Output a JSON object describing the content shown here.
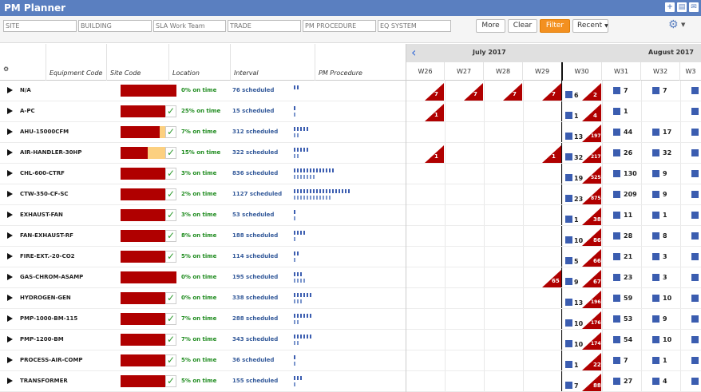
{
  "app": {
    "title": "PM Planner"
  },
  "filters": {
    "site": "SITE",
    "building": "BUILDING",
    "team": "SLA Work Team",
    "trade": "TRADE",
    "procedure": "PM PROCEDURE",
    "eqsystem": "EQ SYSTEM"
  },
  "buttons": {
    "more": "More",
    "clear": "Clear",
    "filter": "Filter",
    "recent": "Recent"
  },
  "columns": [
    "Equipment Code",
    "Site Code",
    "Location",
    "Interval",
    "PM Procedure"
  ],
  "calendar": {
    "months": [
      "July 2017",
      "August 2017"
    ],
    "weeks": [
      "W26",
      "W27",
      "W28",
      "W29",
      "W30",
      "W31",
      "W32",
      "W3"
    ]
  },
  "rows": [
    {
      "code": "N/A",
      "pct": "0% on time",
      "sch": "76 scheduled",
      "amber": 0,
      "check": false,
      "pm": [
        2,
        0
      ],
      "tri": {
        "0": "7",
        "1": "7",
        "2": "7",
        "3": "7"
      },
      "w30": {
        "n": "6",
        "t": "2"
      },
      "w31": "7",
      "w32": "7"
    },
    {
      "code": "A-PC",
      "pct": "25% on time",
      "sch": "15 scheduled",
      "amber": 0,
      "check": true,
      "pm": [
        1,
        1
      ],
      "tri": {
        "0": "1"
      },
      "w30": {
        "n": "1",
        "t": "4"
      },
      "w31": "1",
      "w32": ""
    },
    {
      "code": "AHU-15000CFM",
      "pct": "7% on time",
      "sch": "312 scheduled",
      "amber": 0.12,
      "check": true,
      "pm": [
        5,
        2
      ],
      "tri": {},
      "w30": {
        "n": "13",
        "t": "197"
      },
      "w31": "44",
      "w32": "17"
    },
    {
      "code": "AIR-HANDLER-30HP",
      "pct": "15% on time",
      "sch": "322 scheduled",
      "amber": 0.4,
      "check": true,
      "pm": [
        5,
        2
      ],
      "tri": {
        "0": "1",
        "3": "1"
      },
      "w30": {
        "n": "32",
        "t": "217"
      },
      "w31": "26",
      "w32": "32"
    },
    {
      "code": "CHL-600-CTRF",
      "pct": "3% on time",
      "sch": "836 scheduled",
      "amber": 0,
      "check": true,
      "pm": [
        13,
        7
      ],
      "tri": {},
      "w30": {
        "n": "19",
        "t": "525"
      },
      "w31": "130",
      "w32": "9"
    },
    {
      "code": "CTW-350-CF-SC",
      "pct": "2% on time",
      "sch": "1127 scheduled",
      "amber": 0,
      "check": true,
      "pm": [
        18,
        12
      ],
      "tri": {},
      "w30": {
        "n": "23",
        "t": "875"
      },
      "w31": "209",
      "w32": "9"
    },
    {
      "code": "EXHAUST-FAN",
      "pct": "3% on time",
      "sch": "53 scheduled",
      "amber": 0,
      "check": true,
      "pm": [
        1,
        1
      ],
      "tri": {},
      "w30": {
        "n": "1",
        "t": "38"
      },
      "w31": "11",
      "w32": "1"
    },
    {
      "code": "FAN-EXHAUST-RF",
      "pct": "8% on time",
      "sch": "188 scheduled",
      "amber": 0,
      "check": true,
      "pm": [
        4,
        1
      ],
      "tri": {},
      "w30": {
        "n": "10",
        "t": "86"
      },
      "w31": "28",
      "w32": "8"
    },
    {
      "code": "FIRE-EXT.-20-CO2",
      "pct": "5% on time",
      "sch": "114 scheduled",
      "amber": 0,
      "check": true,
      "pm": [
        2,
        1
      ],
      "tri": {},
      "w30": {
        "n": "5",
        "t": "66"
      },
      "w31": "21",
      "w32": "3"
    },
    {
      "code": "GAS-CHROM-ASAMP",
      "pct": "0% on time",
      "sch": "195 scheduled",
      "amber": 0,
      "check": false,
      "pm": [
        3,
        4
      ],
      "tri": {
        "3": "65"
      },
      "w30": {
        "n": "9",
        "t": "67"
      },
      "w31": "23",
      "w32": "3"
    },
    {
      "code": "HYDROGEN-GEN",
      "pct": "0% on time",
      "sch": "338 scheduled",
      "amber": 0,
      "check": true,
      "pm": [
        6,
        3
      ],
      "tri": {},
      "w30": {
        "n": "13",
        "t": "196"
      },
      "w31": "59",
      "w32": "10"
    },
    {
      "code": "PMP-1000-BM-115",
      "pct": "7% on time",
      "sch": "288 scheduled",
      "amber": 0,
      "check": true,
      "pm": [
        6,
        2
      ],
      "tri": {},
      "w30": {
        "n": "10",
        "t": "176"
      },
      "w31": "53",
      "w32": "9"
    },
    {
      "code": "PMP-1200-BM",
      "pct": "7% on time",
      "sch": "343 scheduled",
      "amber": 0,
      "check": true,
      "pm": [
        6,
        2
      ],
      "tri": {},
      "w30": {
        "n": "10",
        "t": "174"
      },
      "w31": "54",
      "w32": "10"
    },
    {
      "code": "PROCESS-AIR-COMP",
      "pct": "5% on time",
      "sch": "36 scheduled",
      "amber": 0,
      "check": true,
      "pm": [
        1,
        1
      ],
      "tri": {},
      "w30": {
        "n": "1",
        "t": "22"
      },
      "w31": "7",
      "w32": "1"
    },
    {
      "code": "TRANSFORMER",
      "pct": "5% on time",
      "sch": "155 scheduled",
      "amber": 0,
      "check": true,
      "pm": [
        3,
        1
      ],
      "tri": {},
      "w30": {
        "n": "7",
        "t": "88"
      },
      "w31": "27",
      "w32": "4"
    }
  ]
}
